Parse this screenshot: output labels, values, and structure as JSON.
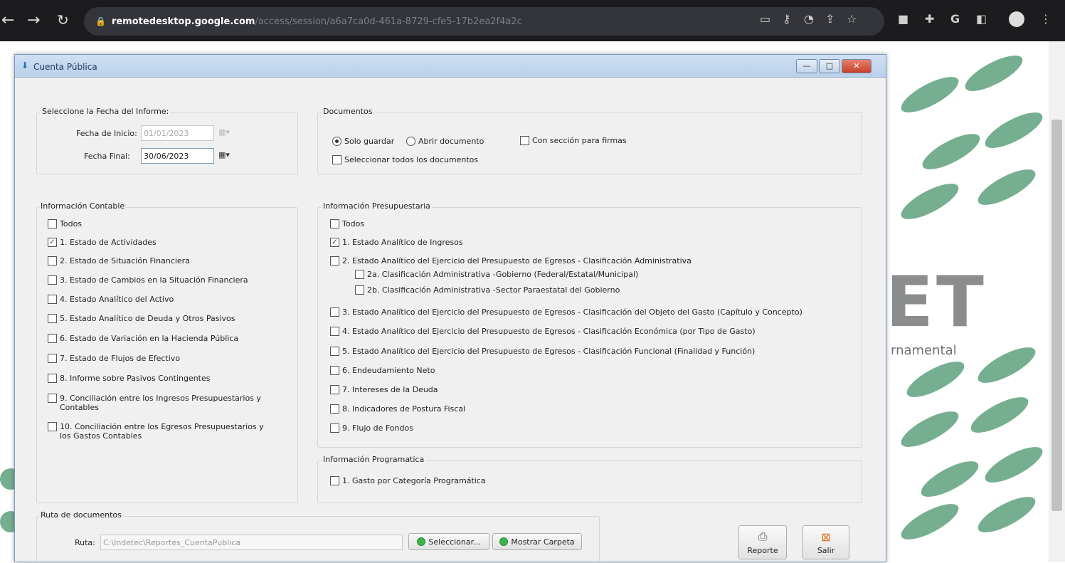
{
  "browser": {
    "url_domain": "remotedesktop.google.com",
    "url_path": "/access/session/a6a7ca0d-461a-8729-cfe5-17b2ea2f4a2c",
    "back_icon": "arrow-left",
    "forward_icon": "arrow-right",
    "reload_icon": "reload",
    "right_icons": [
      "bookmark",
      "key",
      "cast",
      "share",
      "star",
      "extension",
      "puzzle",
      "google",
      "sidepanel",
      "profile",
      "menu"
    ]
  },
  "background": {
    "logo_letters": "ET",
    "subtitle": "rnamental",
    "accent_color": "#5da07d"
  },
  "window": {
    "title": "Cuenta Pública"
  },
  "fecha": {
    "group_title": "Seleccione la Fecha del Informe:",
    "inicio_label": "Fecha de Inicio:",
    "inicio_value": "01/01/2023",
    "final_label": "Fecha Final:",
    "final_value": "30/06/2023"
  },
  "documentos": {
    "group_title": "Documentos",
    "radio_solo": "Solo guardar",
    "radio_abrir": "Abrir documento",
    "selected": "Solo guardar",
    "firmas": "Con sección para firmas",
    "todos": "Seleccionar todos los documentos"
  },
  "contable": {
    "group_title": "Información Contable",
    "items": [
      {
        "label": "Todos",
        "checked": false
      },
      {
        "label": "1. Estado de Actividades",
        "checked": true
      },
      {
        "label": "2. Estado de Situación Financiera",
        "checked": false
      },
      {
        "label": "3. Estado de Cambios en la Situación Financiera",
        "checked": false
      },
      {
        "label": "4. Estado Analítico del Activo",
        "checked": false
      },
      {
        "label": "5. Estado Analítico de Deuda y Otros Pasivos",
        "checked": false
      },
      {
        "label": "6. Estado de Variación en la Hacienda Pública",
        "checked": false
      },
      {
        "label": "7. Estado de Flujos de Efectivo",
        "checked": false
      },
      {
        "label": "8. Informe sobre Pasivos Contingentes",
        "checked": false
      },
      {
        "label": "9. Conciliación entre los Ingresos Presupuestarios y Contables",
        "checked": false
      },
      {
        "label": "10. Conciliación entre los Egresos Presupuestarios y los Gastos Contables",
        "checked": false
      }
    ]
  },
  "presupuestaria": {
    "group_title": "Información Presupuestaria",
    "items": [
      {
        "label": "Todos",
        "checked": false
      },
      {
        "label": "1. Estado Analítico de Ingresos",
        "checked": true
      },
      {
        "label": "2. Estado Analítico del Ejercicio del Presupuesto de Egresos - Clasificación Administrativa",
        "checked": false
      },
      {
        "label": "2a. Clasificación Administrativa -Gobierno (Federal/Estatal/Municipal)",
        "checked": false
      },
      {
        "label": "2b. Clasificación Administrativa -Sector Paraestatal del Gobierno",
        "checked": false
      },
      {
        "label": "3. Estado Analítico del Ejercicio del Presupuesto de Egresos - Clasificación del Objeto del Gasto (Capítulo y Concepto)",
        "checked": false
      },
      {
        "label": "4. Estado Analítico del Ejercicio del Presupuesto de Egresos - Clasificación Económica (por Tipo de Gasto)",
        "checked": false
      },
      {
        "label": "5. Estado Analítico del Ejercicio del Presupuesto de Egresos - Clasificación Funcional (Finalidad y Función)",
        "checked": false
      },
      {
        "label": "6. Endeudamiento Neto",
        "checked": false
      },
      {
        "label": "7. Intereses de la Deuda",
        "checked": false
      },
      {
        "label": "8. Indicadores de Postura Fiscal",
        "checked": false
      },
      {
        "label": "9. Flujo de Fondos",
        "checked": false
      }
    ]
  },
  "programatica": {
    "group_title": "Información Programatica",
    "items": [
      {
        "label": "1. Gasto por Categoría Programática",
        "checked": false
      }
    ]
  },
  "ruta": {
    "group_title": "Ruta de documentos",
    "label": "Ruta:",
    "value": "C:\\Indetec\\Reportes_CuentaPublica",
    "btn_seleccionar": "Seleccionar...",
    "btn_mostrar": "Mostrar Carpeta"
  },
  "actions": {
    "reporte": "Reporte",
    "salir": "Salir"
  }
}
